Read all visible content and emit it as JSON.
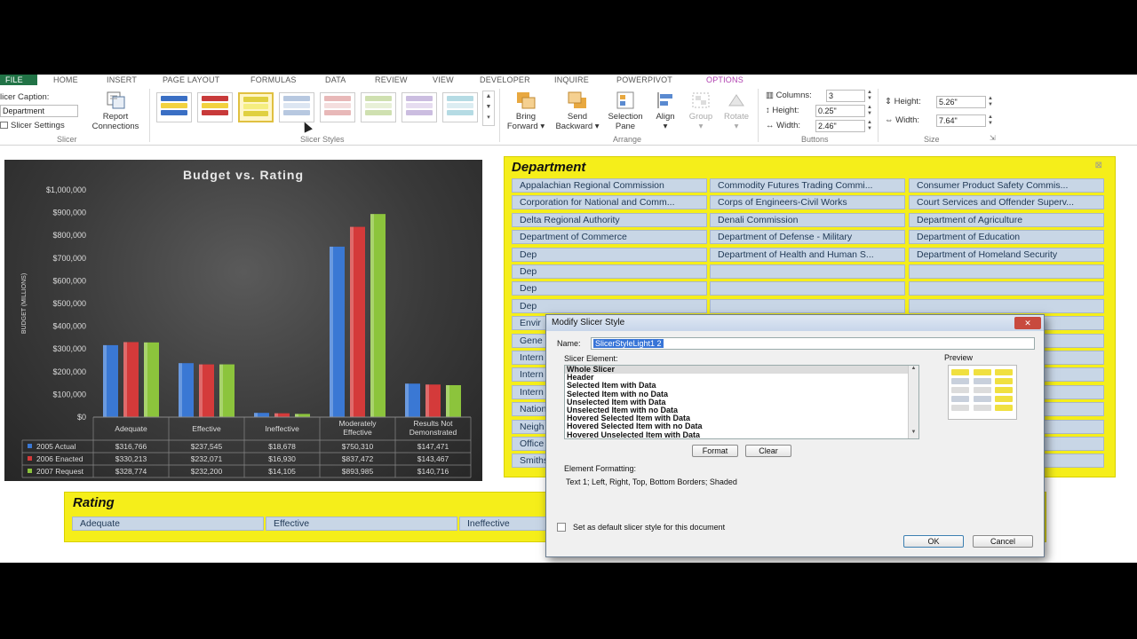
{
  "ribbon": {
    "tabs": [
      "FILE",
      "HOME",
      "INSERT",
      "PAGE LAYOUT",
      "FORMULAS",
      "DATA",
      "REVIEW",
      "VIEW",
      "DEVELOPER",
      "INQUIRE",
      "POWERPIVOT",
      "OPTIONS"
    ],
    "active_tab": "OPTIONS",
    "slicer_group": {
      "caption_label": "licer Caption:",
      "caption_value": "Department",
      "settings_label": "Slicer Settings",
      "report_connections_label": [
        "Report",
        "Connections"
      ],
      "group_label": "Slicer"
    },
    "slicer_styles_label": "Slicer Styles",
    "arrange": {
      "bring_forward": [
        "Bring",
        "Forward ▾"
      ],
      "send_backward": [
        "Send",
        "Backward ▾"
      ],
      "selection_pane": [
        "Selection",
        "Pane"
      ],
      "align": [
        "Align",
        "▾"
      ],
      "group": [
        "Group",
        "▾"
      ],
      "rotate": [
        "Rotate",
        "▾"
      ],
      "group_label": "Arrange"
    },
    "buttons": {
      "columns_label": "Columns:",
      "columns_value": "3",
      "height_label": "Height:",
      "height_value": "0.25\"",
      "width_label": "Width:",
      "width_value": "2.46\"",
      "group_label": "Buttons"
    },
    "size": {
      "height_label": "Height:",
      "height_value": "5.26\"",
      "width_label": "Width:",
      "width_value": "7.64\"",
      "group_label": "Size"
    }
  },
  "colors": {
    "slicer_yellow": "#f5ee1a",
    "item_blue": "#c8d6e6",
    "series_2005_actual": "#3a78d4",
    "series_2006_enacted": "#d43a3a",
    "series_2007_request": "#8cc43c",
    "active_tab": "#b041b0",
    "file_tab": "#217346"
  },
  "chart_data": {
    "type": "bar",
    "title": "Budget vs. Rating",
    "ylabel": "BUDGET (MILLIONS)",
    "xlabel": "",
    "ylim": [
      0,
      1000000
    ],
    "yticks": [
      "$0",
      "$100,000",
      "$200,000",
      "$300,000",
      "$400,000",
      "$500,000",
      "$600,000",
      "$700,000",
      "$800,000",
      "$900,000",
      "$1,000,000"
    ],
    "categories": [
      "Adequate",
      "Effective",
      "Ineffective",
      "Moderately Effective",
      "Results Not Demonstrated"
    ],
    "series": [
      {
        "name": "2005 Actual",
        "values": [
          316766,
          237545,
          18678,
          750310,
          147471
        ],
        "labels": [
          "$316,766",
          "$237,545",
          "$18,678",
          "$750,310",
          "$147,471"
        ]
      },
      {
        "name": "2006 Enacted",
        "values": [
          330213,
          232071,
          16930,
          837472,
          143467
        ],
        "labels": [
          "$330,213",
          "$232,071",
          "$16,930",
          "$837,472",
          "$143,467"
        ]
      },
      {
        "name": "2007 Request",
        "values": [
          328774,
          232200,
          14105,
          893985,
          140716
        ],
        "labels": [
          "$328,774",
          "$232,200",
          "$14,105",
          "$893,985",
          "$140,716"
        ]
      }
    ],
    "grid": false,
    "legend": "data-table"
  },
  "department_slicer": {
    "title": "Department",
    "items": [
      "Appalachian Regional Commission",
      "Commodity Futures Trading Commi...",
      "Consumer Product Safety Commis...",
      "Corporation for National and Comm...",
      "Corps of Engineers-Civil Works",
      "Court Services and Offender Superv...",
      "Delta Regional Authority",
      "Denali Commission",
      "Department of Agriculture",
      "Department of Commerce",
      "Department of Defense - Military",
      "Department of Education",
      "Dep",
      "Department of Health and Human S...",
      "Department of Homeland Security",
      "Dep",
      "",
      "",
      "Dep",
      "",
      "",
      "Dep",
      "",
      "",
      "Envir",
      "",
      "on",
      "Gene",
      "",
      "rograms:...",
      "Intern",
      "",
      "rograms:...",
      "Intern",
      "",
      "",
      "Intern",
      "",
      "Space Ad...",
      "Nation",
      "",
      "on",
      "Neigh",
      "",
      "ntrol Policy",
      "Office",
      "",
      "ition",
      "Smiths",
      "",
      "7"
    ]
  },
  "rating_slicer": {
    "title": "Rating",
    "items": [
      "Adequate",
      "Effective",
      "Ineffective",
      "Moderately Effective",
      "Results Not Demonstrated"
    ]
  },
  "dialog": {
    "title": "Modify Slicer Style",
    "close": "✕",
    "name_label": "Name:",
    "name_value": "SlicerStyleLight1 2",
    "slicer_element_label": "Slicer Element:",
    "elements": [
      "Whole Slicer",
      "Header",
      "Selected Item with Data",
      "Selected Item with no Data",
      "Unselected Item with Data",
      "Unselected Item with no Data",
      "Hovered Selected Item with Data",
      "Hovered Selected Item with no Data",
      "Hovered Unselected Item with Data"
    ],
    "format_label": "Format",
    "clear_label": "Clear",
    "preview_label": "Preview",
    "element_formatting_label": "Element Formatting:",
    "element_formatting_value": "Text 1; Left, Right, Top, Bottom Borders; Shaded",
    "default_checkbox_label": "Set as default slicer style for this document",
    "ok_label": "OK",
    "cancel_label": "Cancel"
  }
}
